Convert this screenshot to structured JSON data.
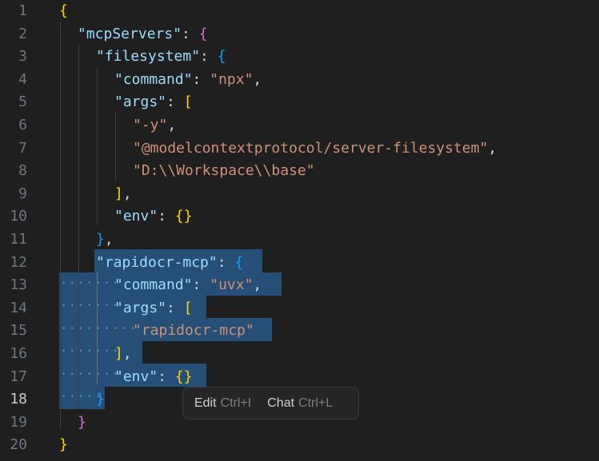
{
  "editor": {
    "active_line": "18",
    "lines": [
      {
        "n": "1"
      },
      {
        "n": "2"
      },
      {
        "n": "3"
      },
      {
        "n": "4"
      },
      {
        "n": "5"
      },
      {
        "n": "6"
      },
      {
        "n": "7"
      },
      {
        "n": "8"
      },
      {
        "n": "9"
      },
      {
        "n": "10"
      },
      {
        "n": "11"
      },
      {
        "n": "12"
      },
      {
        "n": "13"
      },
      {
        "n": "14"
      },
      {
        "n": "15"
      },
      {
        "n": "16"
      },
      {
        "n": "17"
      },
      {
        "n": "18"
      },
      {
        "n": "19"
      },
      {
        "n": "20"
      }
    ],
    "tokens": {
      "l1": [
        "{"
      ],
      "l2": [
        "\"mcpServers\"",
        ": ",
        "{"
      ],
      "l3": [
        "\"filesystem\"",
        ": ",
        "{"
      ],
      "l4": [
        "\"command\"",
        ": ",
        "\"npx\"",
        ","
      ],
      "l5": [
        "\"args\"",
        ": ",
        "["
      ],
      "l6": [
        "\"-y\"",
        ","
      ],
      "l7": [
        "\"@modelcontextprotocol/server-filesystem\"",
        ","
      ],
      "l8": [
        "\"D:\\\\Workspace\\\\base\""
      ],
      "l9": [
        "]",
        ","
      ],
      "l10": [
        "\"env\"",
        ": ",
        "{}"
      ],
      "l11": [
        "}",
        ","
      ],
      "l12": [
        "\"rapidocr-mcp\"",
        ": ",
        "{"
      ],
      "l13": [
        "\"command\"",
        ": ",
        "\"uvx\"",
        ","
      ],
      "l14": [
        "\"args\"",
        ": ",
        "["
      ],
      "l15": [
        "\"rapidocr-mcp\""
      ],
      "l16": [
        "]",
        ","
      ],
      "l17": [
        "\"env\"",
        ": ",
        "{}"
      ],
      "l18": [
        "}"
      ],
      "l19": [
        "}"
      ],
      "l20": [
        "}"
      ]
    }
  },
  "inline_hint": {
    "edit_label": "Edit",
    "edit_shortcut": "Ctrl+I",
    "chat_label": "Chat",
    "chat_shortcut": "Ctrl+L"
  },
  "colors": {
    "background": "#1f1f1f",
    "selection": "#264f78",
    "key": "#9cdcfe",
    "string": "#ce9178",
    "bracket_level1": "#ffd700",
    "bracket_level2": "#da70d6",
    "bracket_level3": "#179fff"
  }
}
